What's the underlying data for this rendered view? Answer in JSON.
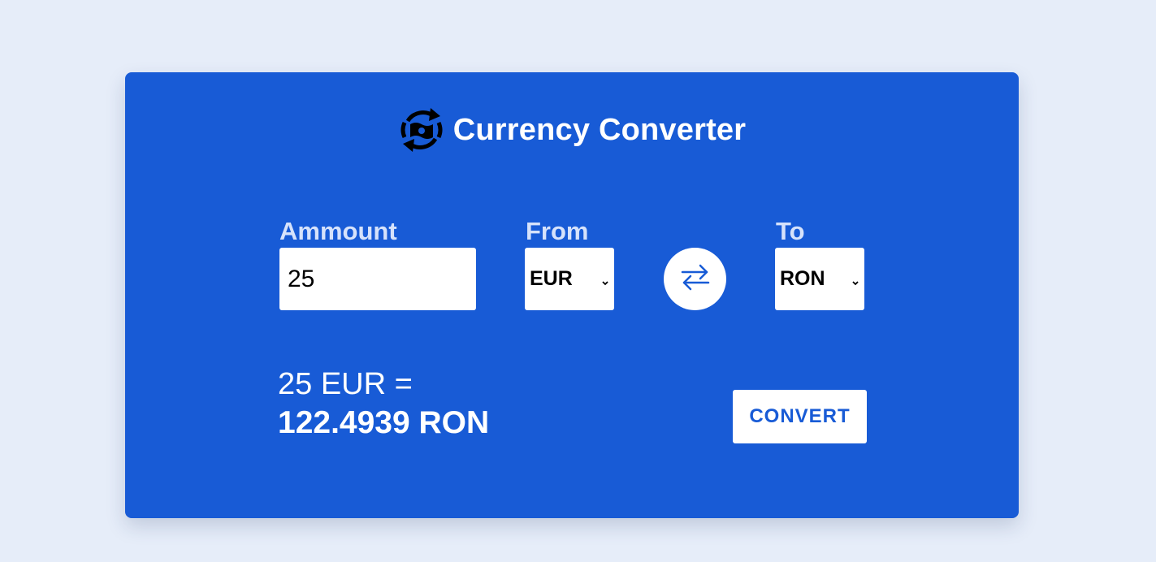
{
  "header": {
    "title": "Currency Converter",
    "logo_icon": "currency-exchange-icon"
  },
  "form": {
    "amount_label": "Ammount",
    "amount_value": "25",
    "from_label": "From",
    "from_value": "EUR",
    "to_label": "To",
    "to_value": "RON",
    "swap_icon": "swap-arrows-icon"
  },
  "result": {
    "from_text": "25 EUR =",
    "to_text": "122.4939 RON"
  },
  "actions": {
    "convert_label": "CONVERT"
  },
  "colors": {
    "page_background": "#e6edf9",
    "card_background": "#185bd6",
    "label_color": "#d6e2fb",
    "text_white": "#ffffff",
    "accent": "#185bd6"
  }
}
